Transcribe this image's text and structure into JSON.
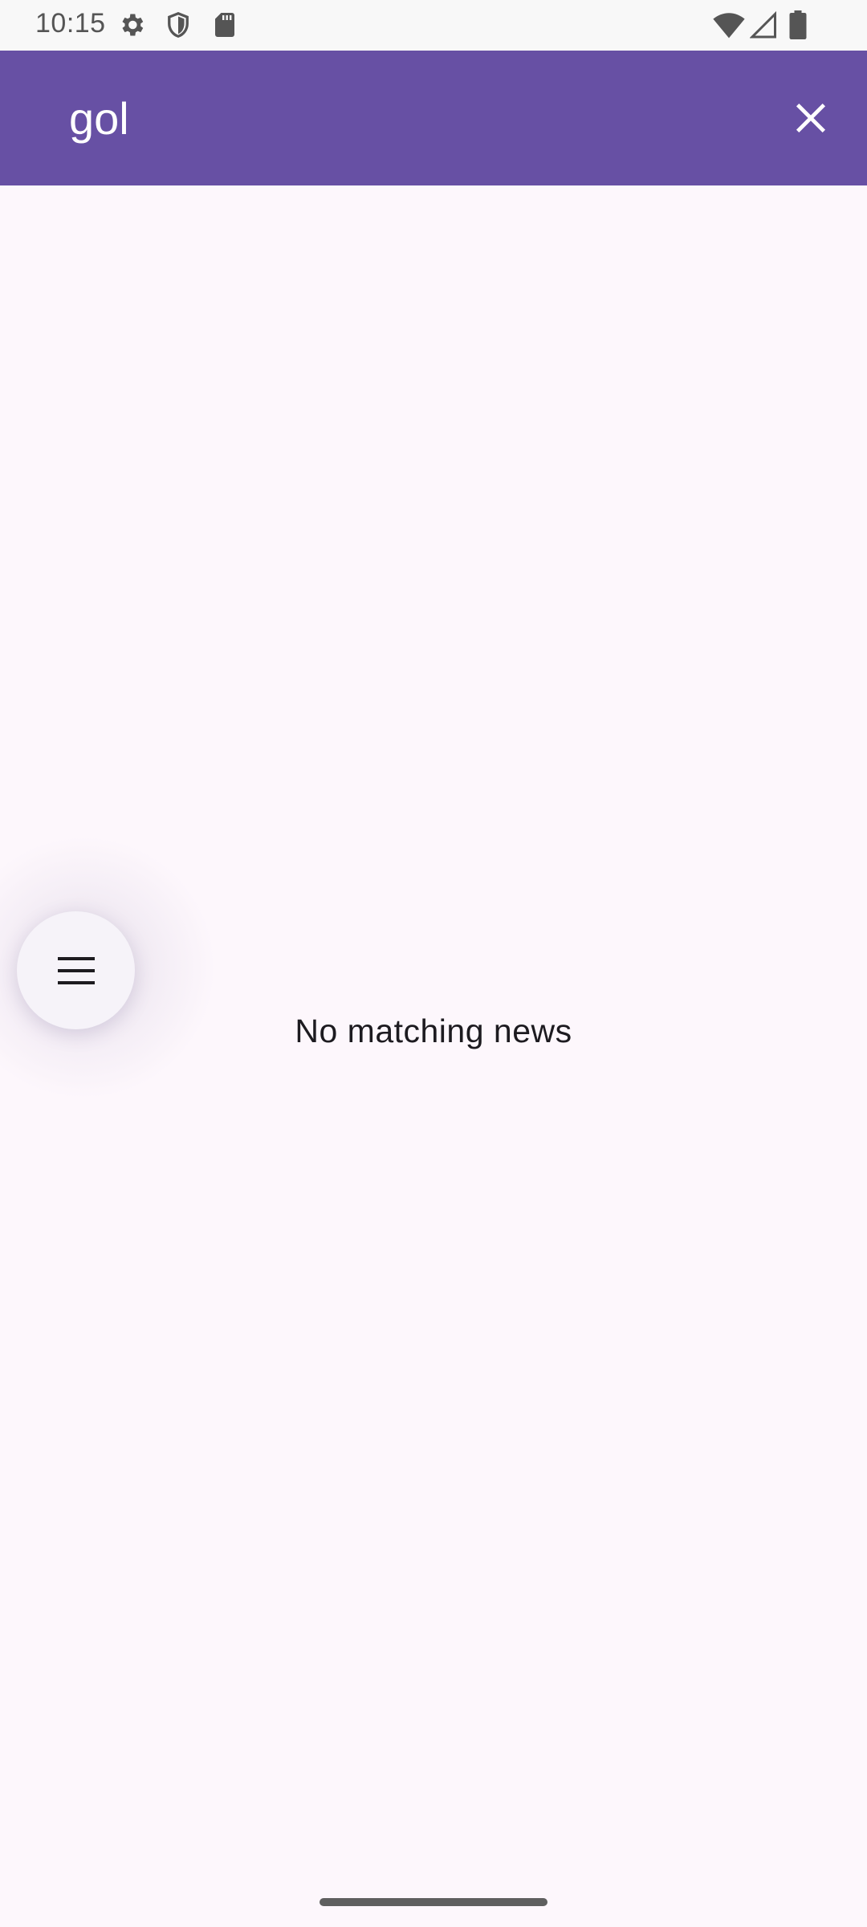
{
  "status_bar": {
    "time": "10:15",
    "icons": [
      "settings-icon",
      "shield-icon",
      "sd-card-icon",
      "wifi-icon",
      "cell-signal-icon",
      "battery-icon"
    ]
  },
  "app_bar": {
    "search_query": "gol",
    "close_icon": "close-icon",
    "background_color": "#6750a4"
  },
  "content": {
    "empty_message": "No matching news"
  },
  "fab": {
    "icon": "menu-icon"
  },
  "colors": {
    "background": "#fdf7fc",
    "accent": "#6750a4",
    "text": "#1d1b20"
  }
}
